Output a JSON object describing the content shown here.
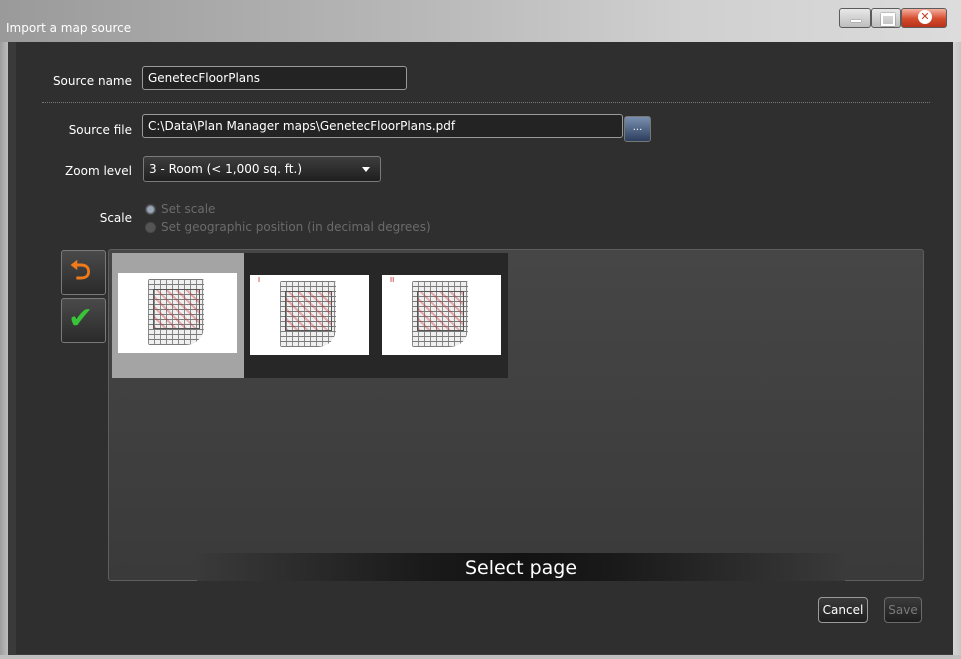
{
  "window": {
    "title": "Import a map source"
  },
  "window_controls": {
    "minimize_icon": "minimize-icon",
    "maximize_icon": "maximize-icon",
    "close_icon": "close-icon"
  },
  "form": {
    "source_name_label": "Source name",
    "source_name_value": "GenetecFloorPlans",
    "source_file_label": "Source file",
    "source_file_value": "C:\\Data\\Plan Manager maps\\GenetecFloorPlans.pdf",
    "browse_label": "...",
    "zoom_level_label": "Zoom level",
    "zoom_level_value": "3 - Room (< 1,000 sq. ft.)",
    "scale_label": "Scale",
    "scale_options": [
      "Set scale",
      "Set geographic position (in decimal degrees)"
    ],
    "scale_selected": 0
  },
  "tools": {
    "undo_icon": "undo-arrow-icon",
    "accept_icon": "checkmark-icon"
  },
  "pages": {
    "thumbnails": [
      {
        "mark": "",
        "selected": true
      },
      {
        "mark": "I",
        "selected": false
      },
      {
        "mark": "II",
        "selected": false
      }
    ],
    "footer_label": "Select page"
  },
  "actions": {
    "cancel_label": "Cancel",
    "save_label": "Save"
  },
  "colors": {
    "background": "#2f2f2f",
    "undo_orange": "#f07a1a",
    "accept_green": "#38c338",
    "close_red": "#d44a2c"
  }
}
